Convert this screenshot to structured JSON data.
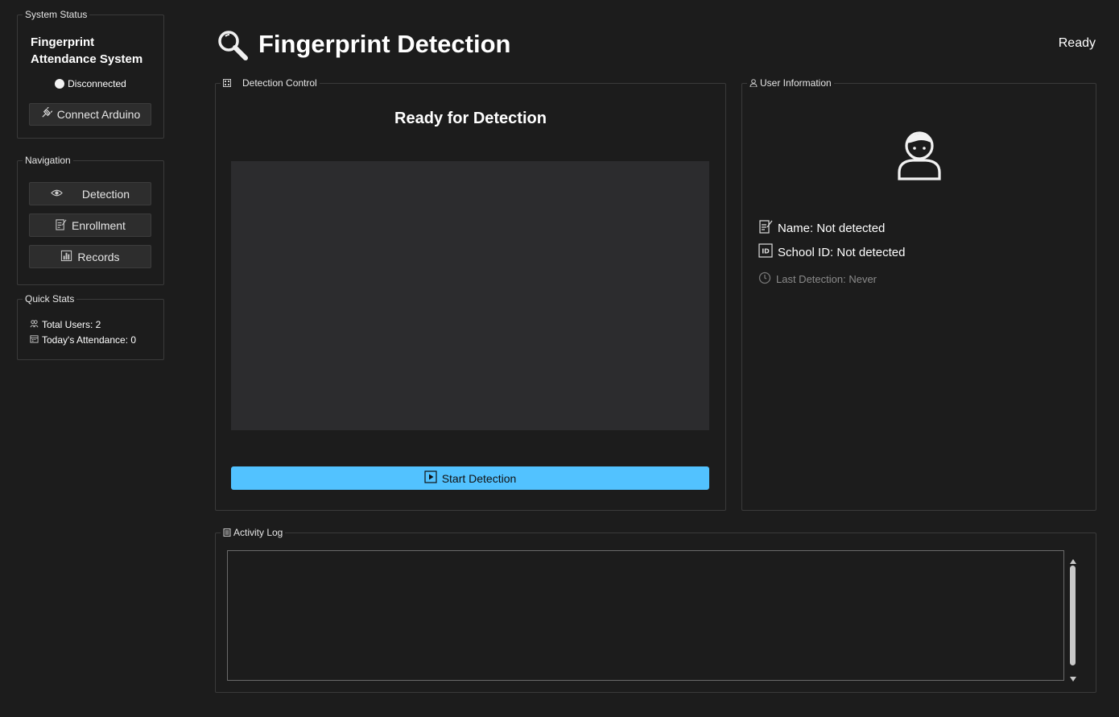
{
  "sidebar": {
    "system_status": {
      "title": "System Status",
      "app_title": "Fingerprint Attendance System",
      "connection": "Disconnected",
      "connect_button": "Connect Arduino"
    },
    "navigation": {
      "title": "Navigation",
      "items": [
        {
          "label": "Detection",
          "icon": "eye-icon"
        },
        {
          "label": "Enrollment",
          "icon": "memo-icon"
        },
        {
          "label": "Records",
          "icon": "bar-chart-icon"
        }
      ]
    },
    "quick_stats": {
      "title": "Quick Stats",
      "total_users": "Total Users: 2",
      "todays_attendance": "Today's Attendance: 0"
    }
  },
  "header": {
    "title": "Fingerprint Detection",
    "icon": "magnifier-icon",
    "status": "Ready"
  },
  "detection_control": {
    "title": "Detection Control",
    "heading": "Ready for Detection",
    "start_button": "Start Detection"
  },
  "user_information": {
    "title": "User Information",
    "name": "Name: Not detected",
    "school_id": "School ID: Not detected",
    "last_detection": "Last Detection: Never"
  },
  "activity_log": {
    "title": "Activity Log",
    "content": ""
  },
  "colors": {
    "background": "#1c1c1c",
    "accent": "#52c2ff",
    "panel_border": "#3a3a3a"
  }
}
